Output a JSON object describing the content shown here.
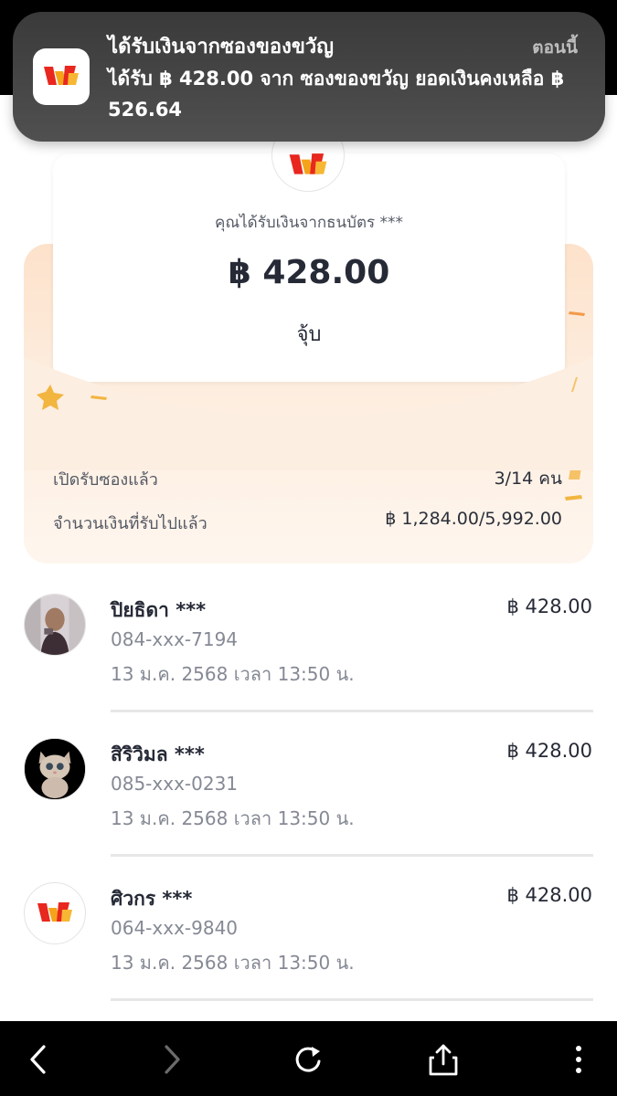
{
  "notification": {
    "app_icon": "gift-envelope-logo-icon",
    "title": "ได้รับเงินจากซองของขวัญ",
    "time": "ตอนนี้",
    "body": "ได้รับ ฿ 428.00 จาก ซองของขวัญ ยอดเงินคงเหลือ ฿ 526.64"
  },
  "envelope": {
    "logo_icon": "gift-envelope-logo-icon",
    "subtitle": "คุณได้รับเงินจากธนบัตร ***",
    "amount": "฿ 428.00",
    "recipient": "จุ้บ",
    "opened_label": "เปิดรับซองแล้ว",
    "opened_value": "3/14 คน",
    "received_label": "จำนวนเงินที่รับไปแล้ว",
    "received_value": "฿ 1,284.00/5,992.00"
  },
  "recipients": [
    {
      "name": "ปิยธิดา ***",
      "phone": "084-xxx-7194",
      "datetime": "13 ม.ค. 2568 เวลา 13:50 น.",
      "amount": "฿ 428.00",
      "avatar": "profile-photo"
    },
    {
      "name": "สิริวิมล ***",
      "phone": "085-xxx-0231",
      "datetime": "13 ม.ค. 2568 เวลา 13:50 น.",
      "amount": "฿ 428.00",
      "avatar": "kitten-photo"
    },
    {
      "name": "ศิวกร ***",
      "phone": "064-xxx-9840",
      "datetime": "13 ม.ค. 2568 เวลา 13:50 น.",
      "amount": "฿ 428.00",
      "avatar": "gift-envelope-logo-icon"
    }
  ],
  "nav": {
    "back_icon": "chevron-left-icon",
    "forward_icon": "chevron-right-icon",
    "reload_icon": "reload-icon",
    "share_icon": "share-icon",
    "more_icon": "more-vertical-icon"
  },
  "colors": {
    "brand_red": "#e8271f",
    "brand_orange": "#f5a31a",
    "envelope_peach": "#fde2cb",
    "text_dark": "#262a36",
    "text_gray": "#858994"
  }
}
